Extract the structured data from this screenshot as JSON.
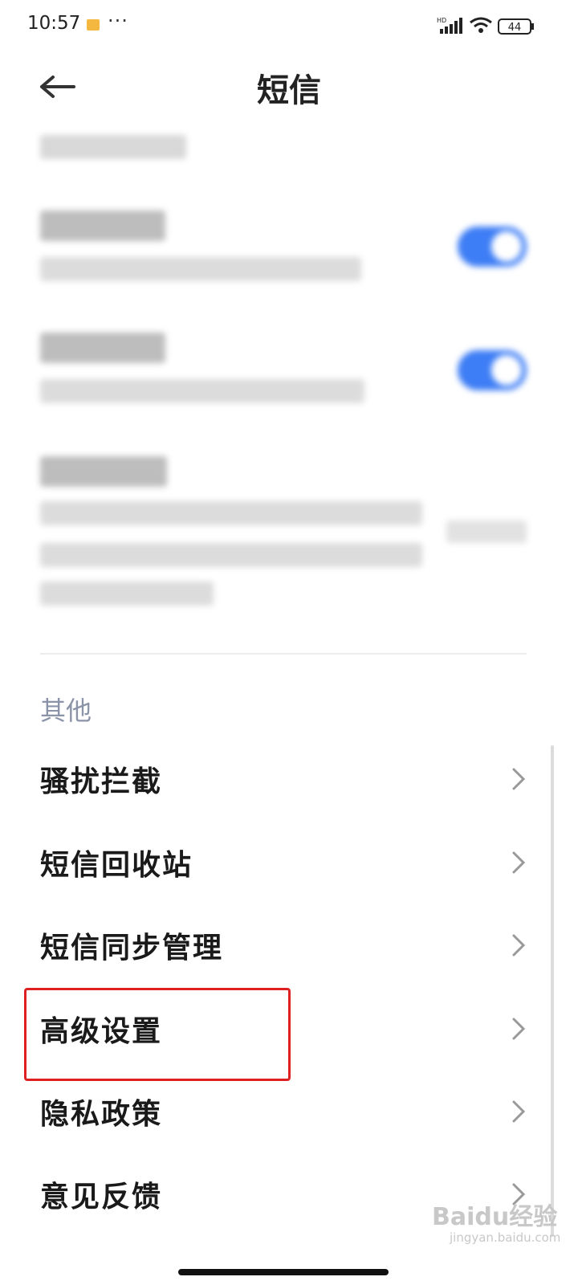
{
  "status_bar": {
    "time": "10:57",
    "more": "···",
    "signal_label": "HD",
    "battery": "44"
  },
  "header": {
    "back_icon": "arrow-left-icon",
    "title": "短信"
  },
  "blurred_settings": [
    {
      "title": "",
      "subtitle": "",
      "toggle_on": true
    },
    {
      "title": "",
      "subtitle": "",
      "toggle_on": true
    },
    {
      "title": "",
      "subtitle": "",
      "value": ""
    }
  ],
  "others_section": {
    "header": "其他",
    "items": [
      {
        "label": "骚扰拦截",
        "icon": "chevron-right-icon"
      },
      {
        "label": "短信回收站",
        "icon": "chevron-right-icon"
      },
      {
        "label": "短信同步管理",
        "icon": "chevron-right-icon"
      },
      {
        "label": "高级设置",
        "icon": "chevron-right-icon"
      },
      {
        "label": "隐私政策",
        "icon": "chevron-right-icon"
      },
      {
        "label": "意见反馈",
        "icon": "chevron-right-icon"
      }
    ]
  },
  "colors": {
    "accent": "#3d7df5",
    "highlight": "#e02020",
    "section_header": "#8a93a8"
  }
}
